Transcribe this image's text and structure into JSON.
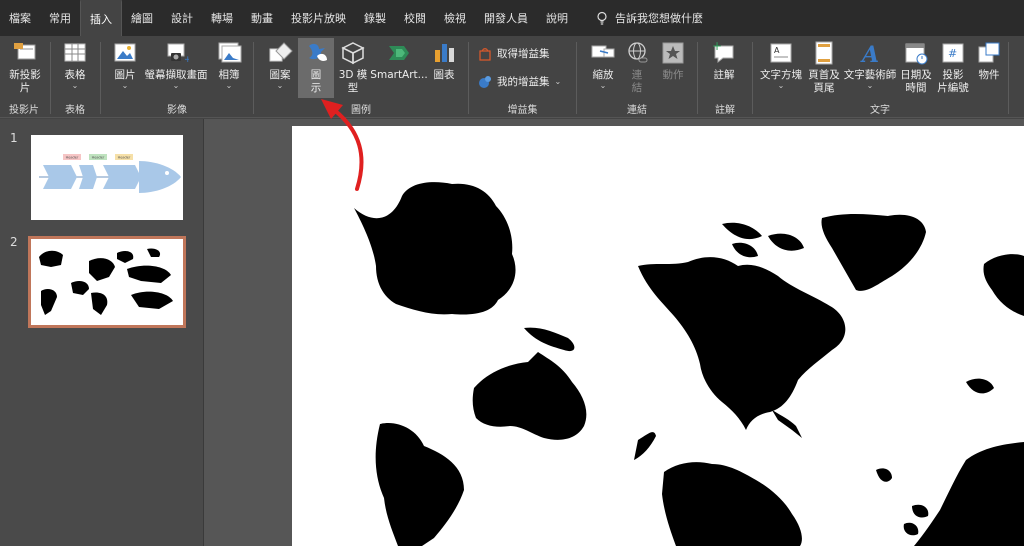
{
  "tabs": [
    {
      "label": "檔案",
      "active": false
    },
    {
      "label": "常用",
      "active": false
    },
    {
      "label": "插入",
      "active": true
    },
    {
      "label": "繪圖",
      "active": false
    },
    {
      "label": "設計",
      "active": false
    },
    {
      "label": "轉場",
      "active": false
    },
    {
      "label": "動畫",
      "active": false
    },
    {
      "label": "投影片放映",
      "active": false
    },
    {
      "label": "錄製",
      "active": false
    },
    {
      "label": "校閱",
      "active": false
    },
    {
      "label": "檢視",
      "active": false
    },
    {
      "label": "開發人員",
      "active": false
    },
    {
      "label": "說明",
      "active": false
    }
  ],
  "tell_me": "告訴我您想做什麼",
  "ribbon": {
    "slides": {
      "new_slide_line1": "新投影",
      "new_slide_line2": "片",
      "group": "投影片"
    },
    "tables": {
      "table": "表格",
      "group": "表格"
    },
    "images": {
      "picture": "圖片",
      "screenshot": "螢幕擷取畫面",
      "album": "相簿",
      "group": "影像"
    },
    "illustrations": {
      "shapes": "圖案",
      "icons_line1": "圖",
      "icons_line2": "示",
      "model_line1": "3D 模",
      "model_line2": "型",
      "smartart": "SmartArt...",
      "chart": "圖表",
      "group": "圖例"
    },
    "addins": {
      "get": "取得增益集",
      "mine": "我的增益集",
      "group": "增益集"
    },
    "links": {
      "zoom": "縮放",
      "link_line1": "連",
      "link_line2": "結",
      "action": "動作",
      "group": "連結"
    },
    "comments": {
      "comment": "註解",
      "group": "註解"
    },
    "text": {
      "textbox": "文字方塊",
      "header_line1": "頁首及",
      "header_line2": "頁尾",
      "wordart": "文字藝術師",
      "date_line1": "日期及",
      "date_line2": "時間",
      "slidenum_line1": "投影",
      "slidenum_line2": "片編號",
      "object": "物件",
      "group": "文字"
    }
  },
  "thumbnails": [
    {
      "number": "1",
      "labels": [
        "Header",
        "Header",
        "Header"
      ]
    },
    {
      "number": "2"
    }
  ],
  "colors": {
    "accent": "#c0765a",
    "annotation": "#e02020",
    "fish": "#a9c8e8"
  }
}
